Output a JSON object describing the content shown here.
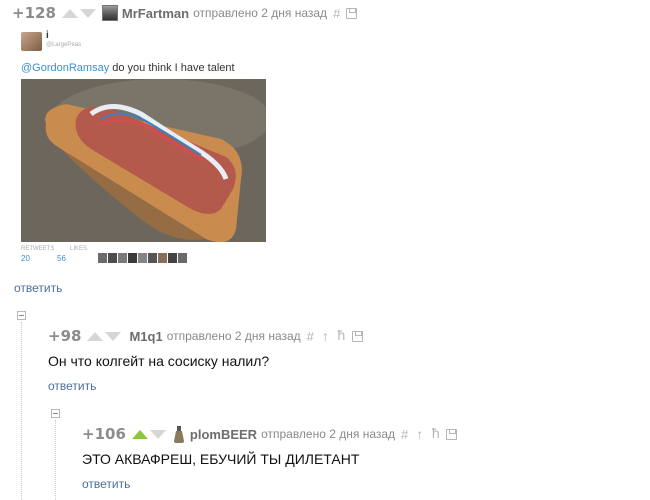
{
  "comments": [
    {
      "rating": "+128",
      "author": "MrFartman",
      "sent": "отправлено 2 дня назад",
      "hash": "#",
      "reply": "ответить",
      "tweet": {
        "name": "i",
        "handle": "@LargePeas",
        "mention": "@GordonRamsay",
        "text": " do you think I have talent",
        "stats_labels": [
          "RETWEETS",
          "LIKES"
        ],
        "stats_values": [
          "20",
          "56"
        ]
      }
    },
    {
      "rating": "+98",
      "author": "M1q1",
      "sent": "отправлено 2 дня назад",
      "hash": "#",
      "up": "↑",
      "branch": "ħ",
      "text": "Он что колгейт на сосиску налил?",
      "reply": "ответить"
    },
    {
      "rating": "+106",
      "author": "plomBEER",
      "sent": "отправлено 2 дня назад",
      "hash": "#",
      "up": "↑",
      "branch": "ħ",
      "text": "ЭТО АКВАФРЕШ, ЕБУЧИЙ ТЫ ДИЛЕТАНТ",
      "reply": "ответить"
    }
  ],
  "colors": {
    "upvote_active": "#8cc63f",
    "link": "#4a6f9f",
    "rating": "#8c8c8c",
    "author": "#6d6d6d"
  },
  "icons": [
    "upvote-arrow-icon",
    "downvote-arrow-icon",
    "permalink-icon",
    "save-icon",
    "parent-arrow-icon",
    "tree-icon",
    "collapse-icon"
  ]
}
